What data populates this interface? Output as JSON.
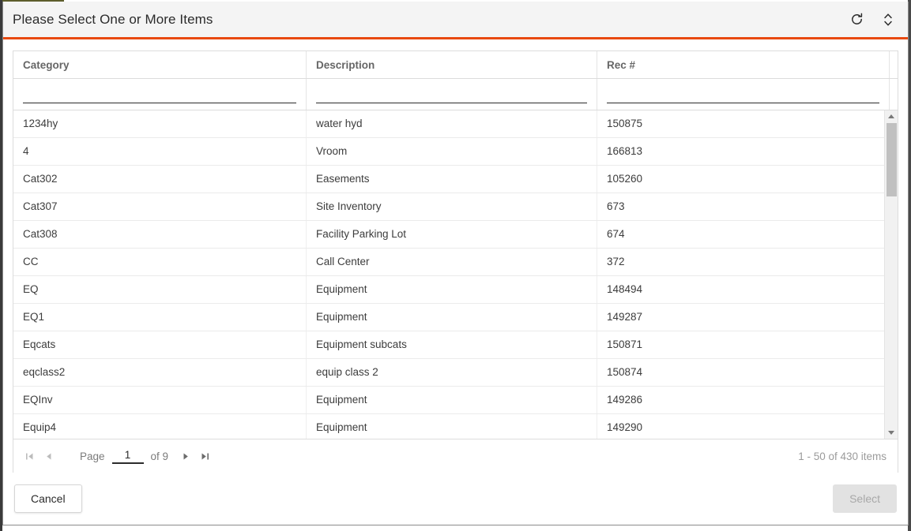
{
  "dialog": {
    "title": "Please Select One or More Items",
    "refresh_icon": "refresh-icon",
    "resize_icon": "expand-collapse-icon"
  },
  "grid": {
    "columns": [
      {
        "key": "category",
        "label": "Category",
        "filter_value": "",
        "filter_placeholder": ""
      },
      {
        "key": "description",
        "label": "Description",
        "filter_value": "",
        "filter_placeholder": ""
      },
      {
        "key": "rec",
        "label": "Rec #",
        "filter_value": "",
        "filter_placeholder": ""
      }
    ],
    "rows": [
      {
        "category": "1234hy",
        "description": "water hyd",
        "rec": "150875"
      },
      {
        "category": "4",
        "description": "Vroom",
        "rec": "166813"
      },
      {
        "category": "Cat302",
        "description": "Easements",
        "rec": "105260"
      },
      {
        "category": "Cat307",
        "description": "Site Inventory",
        "rec": "673"
      },
      {
        "category": "Cat308",
        "description": "Facility Parking Lot",
        "rec": "674"
      },
      {
        "category": "CC",
        "description": "Call Center",
        "rec": "372"
      },
      {
        "category": "EQ",
        "description": "Equipment",
        "rec": "148494"
      },
      {
        "category": "EQ1",
        "description": "Equipment",
        "rec": "149287"
      },
      {
        "category": "Eqcats",
        "description": "Equipment subcats",
        "rec": "150871"
      },
      {
        "category": "eqclass2",
        "description": "equip class 2",
        "rec": "150874"
      },
      {
        "category": "EQInv",
        "description": "Equipment",
        "rec": "149286"
      },
      {
        "category": "Equip4",
        "description": "Equipment",
        "rec": "149290"
      }
    ]
  },
  "pager": {
    "first_label": "first-page",
    "prev_label": "previous-page",
    "page_label": "Page",
    "page_value": "1",
    "of_label": "of 9",
    "next_label": "next-page",
    "last_label": "last-page",
    "count_text": "1 - 50 of 430 items"
  },
  "footer": {
    "cancel_label": "Cancel",
    "select_label": "Select"
  },
  "colors": {
    "accent": "#e8490f",
    "title_bar_bg": "#f4f4f4",
    "header_text": "#666666",
    "row_text": "#3c3c3c",
    "muted_text": "#9b9b9b",
    "scrollbar_thumb": "#c0c0c0",
    "disabled_button_bg": "#e2e2e2"
  }
}
